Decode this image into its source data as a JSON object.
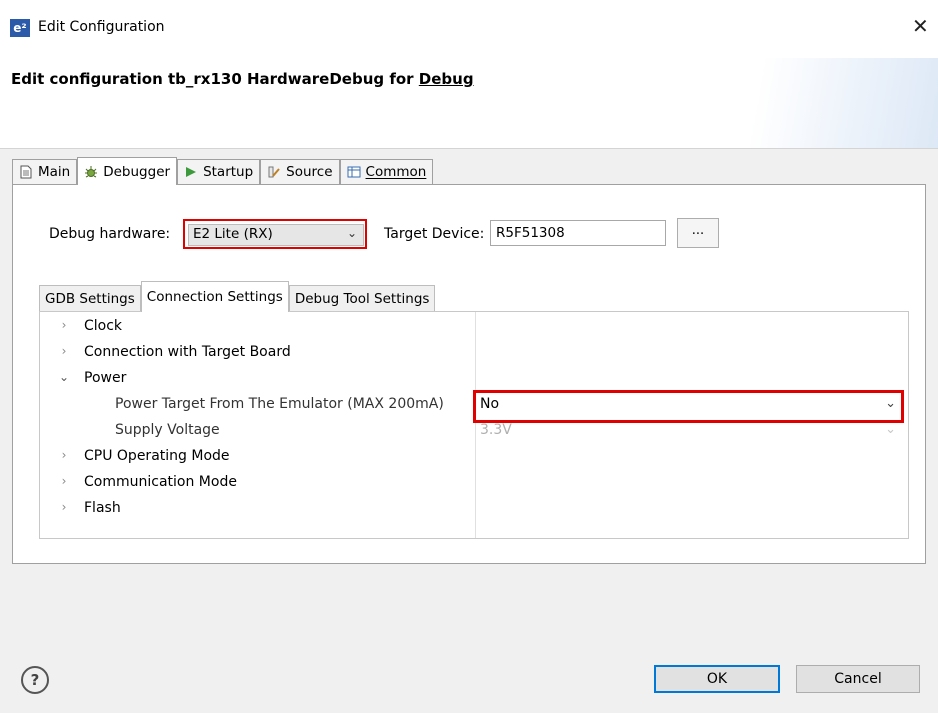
{
  "window": {
    "icon_label": "e²",
    "title": "Edit Configuration",
    "close_glyph": "✕"
  },
  "header": {
    "title_prefix": "Edit configuration tb_rx130 HardwareDebug for ",
    "title_mode": "Debug"
  },
  "tabs": [
    {
      "label": "Main",
      "icon": "document-icon"
    },
    {
      "label": "Debugger",
      "icon": "bug-icon",
      "active": true
    },
    {
      "label": "Startup",
      "icon": "play-icon"
    },
    {
      "label": "Source",
      "icon": "source-icon"
    },
    {
      "label": "Common",
      "icon": "table-icon"
    }
  ],
  "debugger": {
    "hardware_label": "Debug hardware:",
    "hardware_value": "E2 Lite (RX)",
    "target_label": "Target Device:",
    "target_value": "R5F51308",
    "browse_label": "..."
  },
  "inner_tabs": [
    {
      "label": "GDB Settings"
    },
    {
      "label": "Connection Settings",
      "active": true
    },
    {
      "label": "Debug Tool Settings"
    }
  ],
  "settings": {
    "clock": "Clock",
    "connection": "Connection with Target Board",
    "power": "Power",
    "power_target": "Power Target From The Emulator (MAX 200mA)",
    "power_target_value": "No",
    "supply_voltage": "Supply Voltage",
    "supply_voltage_value": "3.3V",
    "cpu_mode": "CPU Operating Mode",
    "comm_mode": "Communication Mode",
    "flash": "Flash"
  },
  "buttons": {
    "help": "?",
    "ok": "OK",
    "cancel": "Cancel"
  },
  "colors": {
    "highlight": "#e00000",
    "accent": "#0078d7"
  }
}
